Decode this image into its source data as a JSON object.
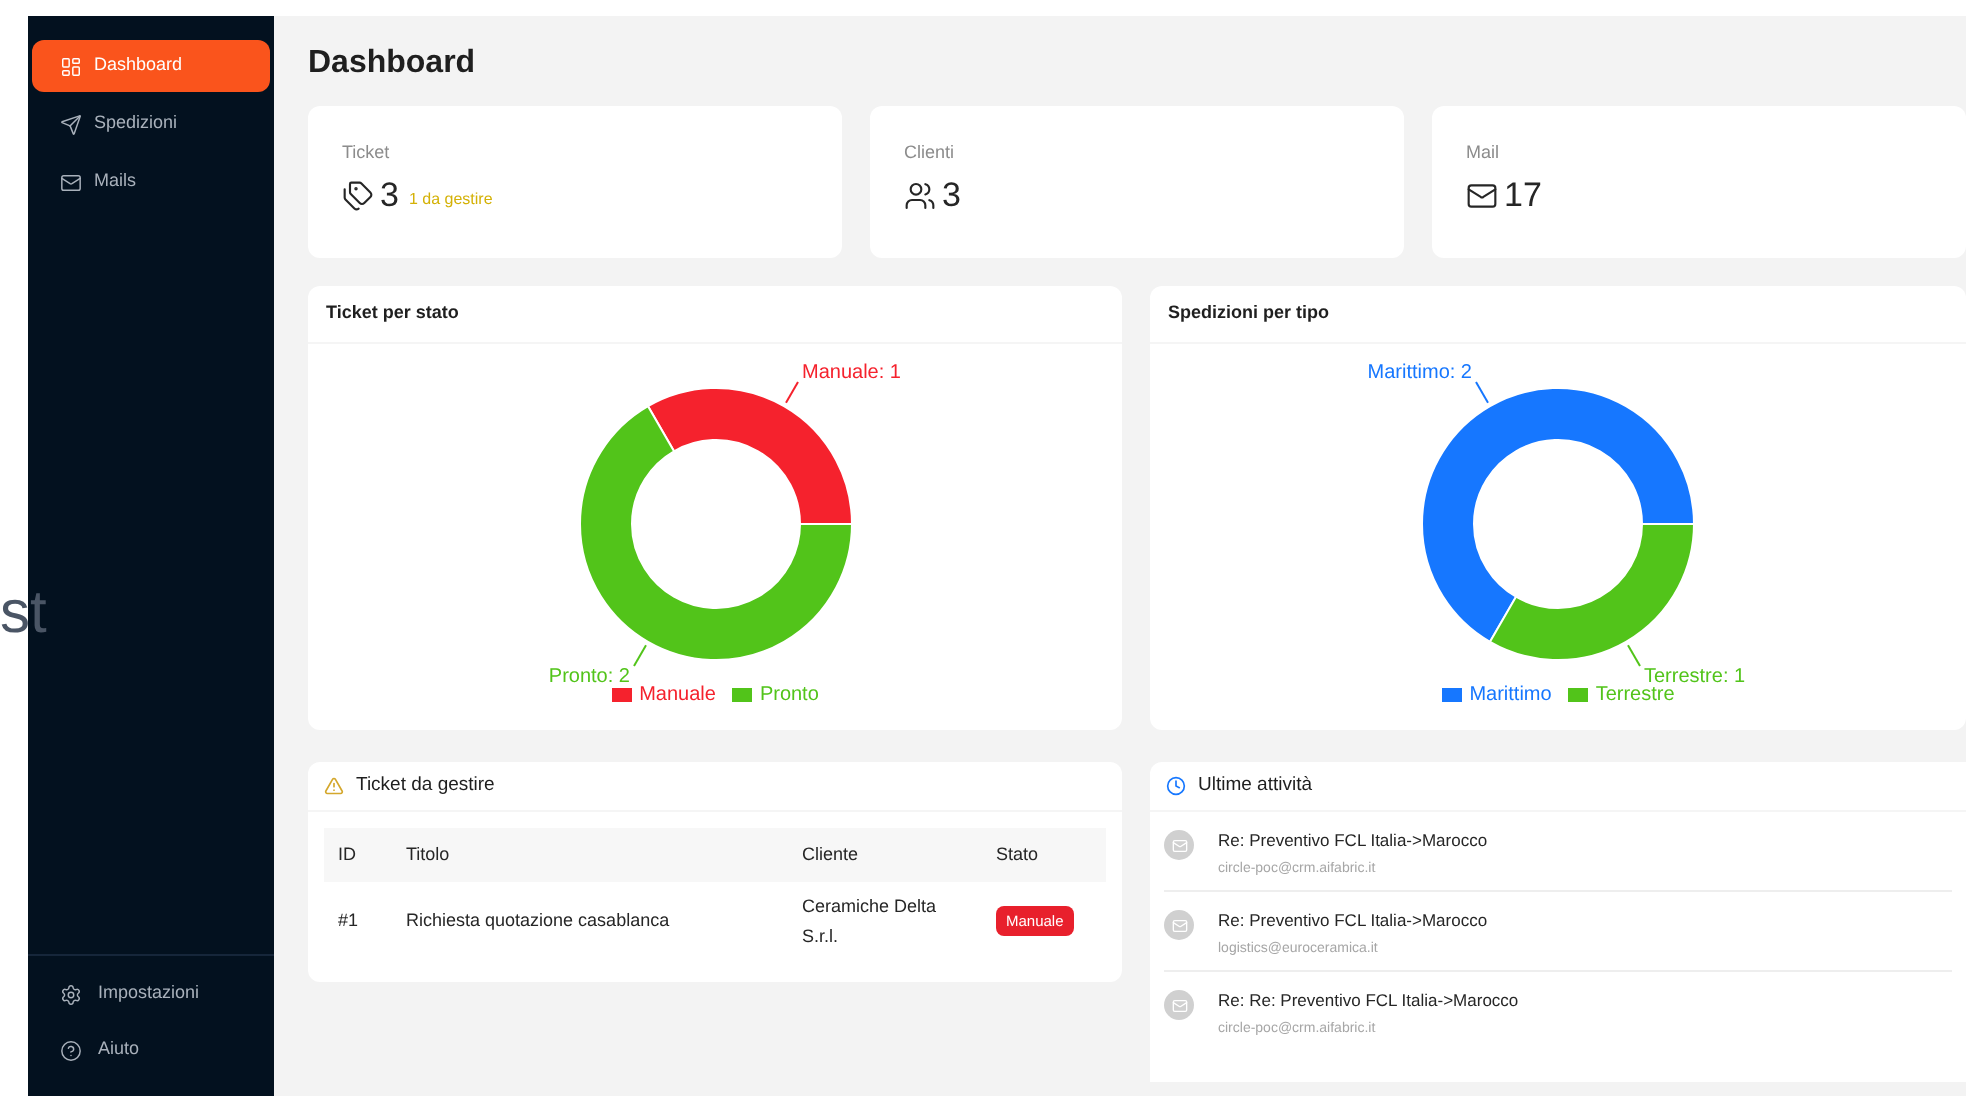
{
  "background_fragment": "st",
  "sidebar": {
    "items": [
      {
        "label": "Dashboard",
        "selected": true
      },
      {
        "label": "Spedizioni",
        "selected": false
      },
      {
        "label": "Mails",
        "selected": false
      }
    ],
    "footer_items": [
      {
        "label": "Impostazioni"
      },
      {
        "label": "Aiuto"
      }
    ]
  },
  "page_title": "Dashboard",
  "stats": [
    {
      "label": "Ticket",
      "value": "3",
      "note": "1 da gestire"
    },
    {
      "label": "Clienti",
      "value": "3"
    },
    {
      "label": "Mail",
      "value": "17"
    }
  ],
  "charts": [
    {
      "title": "Ticket per stato",
      "chart_data": {
        "type": "donut",
        "categories": [
          "Manuale",
          "Pronto"
        ],
        "values": [
          1,
          2
        ],
        "legend": "bottom",
        "colors": [
          "#f5222d",
          "#52c41a"
        ],
        "value_labels": [
          "Manuale: 1",
          "Pronto: 2"
        ]
      }
    },
    {
      "title": "Spedizioni per tipo",
      "chart_data": {
        "type": "donut",
        "categories": [
          "Marittimo",
          "Terrestre"
        ],
        "values": [
          2,
          1
        ],
        "legend": "bottom",
        "colors": [
          "#1677ff",
          "#52c41a"
        ],
        "value_labels": [
          "Marittimo: 2",
          "Terrestre: 1"
        ]
      }
    }
  ],
  "tickets_panel": {
    "title": "Ticket da gestire",
    "table": {
      "columns": [
        "ID",
        "Titolo",
        "Cliente",
        "Stato"
      ],
      "rows": [
        {
          "id": "#1",
          "title": "Richiesta quotazione casablanca",
          "client": "Ceramiche Delta S.r.l.",
          "status": "Manuale"
        }
      ]
    }
  },
  "activity_panel": {
    "title": "Ultime attività",
    "items": [
      {
        "subject": "Re: Preventivo FCL Italia->Marocco",
        "sender": "circle-poc@crm.aifabric.it"
      },
      {
        "subject": "Re: Preventivo FCL Italia->Marocco",
        "sender": "logistics@euroceramica.it"
      },
      {
        "subject": "Re: Re: Preventivo FCL Italia->Marocco",
        "sender": "circle-poc@crm.aifabric.it"
      }
    ]
  }
}
